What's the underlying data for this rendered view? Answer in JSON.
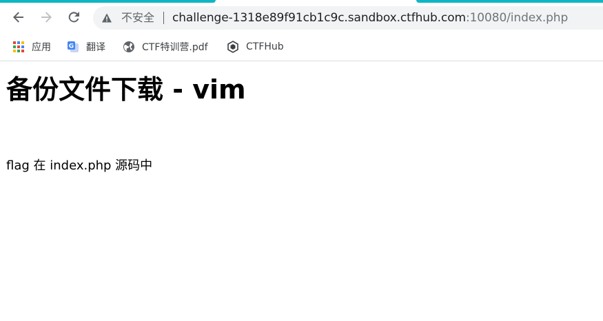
{
  "browser": {
    "security_label": "不安全",
    "url_host": "challenge-1318e89f91cb1c9c.sandbox.ctfhub.com",
    "url_path": ":10080/index.php",
    "accent_color": "#0fb7c4"
  },
  "toolbar": {
    "back_icon": "arrow-left-icon",
    "forward_icon": "arrow-right-icon",
    "reload_icon": "reload-icon",
    "security_icon": "warning-triangle-icon"
  },
  "bookmarks": [
    {
      "label": "应用",
      "icon": "apps-grid-icon"
    },
    {
      "label": "翻译",
      "icon": "translate-icon"
    },
    {
      "label": "CTF特训营.pdf",
      "icon": "globe-icon"
    },
    {
      "label": "CTFHub",
      "icon": "ctfhub-cube-icon"
    }
  ],
  "page": {
    "heading": "备份文件下载 - vim",
    "text": "flag 在 index.php 源码中"
  }
}
